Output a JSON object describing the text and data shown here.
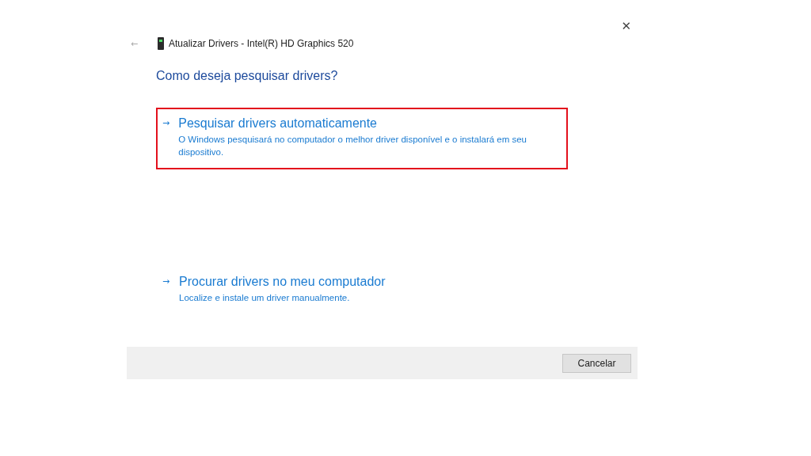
{
  "window": {
    "back": "←",
    "title": "Atualizar Drivers - Intel(R) HD Graphics 520",
    "close": "✕"
  },
  "heading": "Como deseja pesquisar drivers?",
  "options": [
    {
      "arrow": "→",
      "title": "Pesquisar drivers automaticamente",
      "description": "O Windows pesquisará no computador o melhor driver disponível e o instalará em seu dispositivo.",
      "selected": true
    },
    {
      "arrow": "→",
      "title": "Procurar drivers no meu computador",
      "description": "Localize e instale um driver manualmente.",
      "selected": false
    }
  ],
  "buttons": [
    "Cancelar"
  ]
}
